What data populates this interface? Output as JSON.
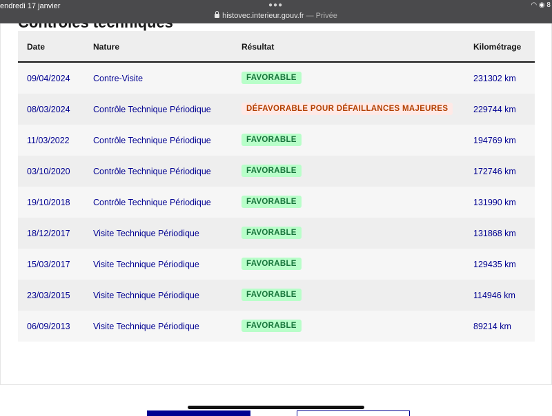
{
  "status_bar": {
    "datetime": "endredi 17 janvier",
    "dots": "●●●",
    "address": "histovec.interieur.gouv.fr",
    "private": "— Privée",
    "sys_icons": "◠ ◉ 8"
  },
  "section": {
    "title": "Contrôles techniques"
  },
  "table": {
    "headers": {
      "date": "Date",
      "nature": "Nature",
      "result": "Résultat",
      "km": "Kilométrage"
    },
    "rows": [
      {
        "date": "09/04/2024",
        "nature": "Contre-Visite",
        "result": "FAVORABLE",
        "km": "231302 km"
      },
      {
        "date": "08/03/2024",
        "nature": "Contrôle Technique Périodique",
        "result": "DÉFAVORABLE POUR DÉFAILLANCES MAJEURES",
        "km": "229744 km"
      },
      {
        "date": "11/03/2022",
        "nature": "Contrôle Technique Périodique",
        "result": "FAVORABLE",
        "km": "194769 km"
      },
      {
        "date": "03/10/2020",
        "nature": "Contrôle Technique Périodique",
        "result": "FAVORABLE",
        "km": "172746 km"
      },
      {
        "date": "19/10/2018",
        "nature": "Contrôle Technique Périodique",
        "result": "FAVORABLE",
        "km": "131990 km"
      },
      {
        "date": "18/12/2017",
        "nature": "Visite Technique Périodique",
        "result": "FAVORABLE",
        "km": "131868 km"
      },
      {
        "date": "15/03/2017",
        "nature": "Visite Technique Périodique",
        "result": "FAVORABLE",
        "km": "129435 km"
      },
      {
        "date": "23/03/2015",
        "nature": "Visite Technique Périodique",
        "result": "FAVORABLE",
        "km": "114946 km"
      },
      {
        "date": "06/09/2013",
        "nature": "Visite Technique Périodique",
        "result": "FAVORABLE",
        "km": "89214 km"
      }
    ]
  },
  "colors": {
    "text_blue": "#000091",
    "favorable_bg": "#b8fec9",
    "favorable_text": "#18753c",
    "defavorable_bg": "#ffe9e6",
    "defavorable_text": "#b34000"
  }
}
